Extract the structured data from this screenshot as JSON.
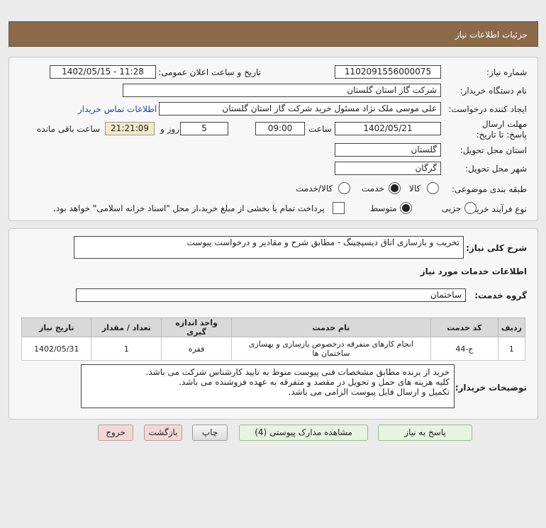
{
  "header": {
    "title": "جزئیات اطلاعات نیاز"
  },
  "form": {
    "need_number_label": "شماره نیاز:",
    "need_number": "1102091556000075",
    "announce_label": "تاریخ و ساعت اعلان عمومی:",
    "announce_value": "1402/05/15 - 11:28",
    "buyer_org_label": "نام دستگاه خریدار:",
    "buyer_org": "شرکت گاز استان گلستان",
    "creator_label": "ایجاد کننده درخواست:",
    "creator": "علی موسی ملک نژاد مسئول خرید شرکت گاز استان گلستان",
    "contact_link": "اطلاعات تماس خریدار",
    "deadline_label": "مهلت ارسال پاسخ: تا تاریخ:",
    "deadline_date": "1402/05/21",
    "time_label": "ساعت",
    "deadline_time": "09:00",
    "days_label": "روز و",
    "days": "5",
    "remaining_time": "21:21:09",
    "remaining_label": "ساعت باقی مانده",
    "province_label": "استان محل تحویل:",
    "province": "گلستان",
    "city_label": "شهر محل تحویل:",
    "city": "گرگان",
    "category_label": "طبقه بندی موضوعی:",
    "category_options": [
      "کالا",
      "خدمت",
      "کالا/خدمت"
    ],
    "category_selected": "خدمت",
    "process_label": "نوع فرآیند خرید :",
    "process_options": [
      "جزیی",
      "متوسط"
    ],
    "process_selected": "متوسط",
    "payment_note": "پرداخت تمام یا بخشی از مبلغ خرید،از محل \"اسناد خزانه اسلامی\" خواهد بود."
  },
  "details": {
    "summary_label": "شرح کلی نیاز:",
    "summary": "تخریب و بازسازی اتاق دیسپچینگ - مطابق شرح و مقادیر و درخواست پیوست",
    "services_heading": "اطلاعات خدمات مورد نیاز",
    "service_group_label": "گروه خدمت:",
    "service_group": "ساختمان",
    "table": {
      "headers": [
        "ردیف",
        "کد خدمت",
        "نام خدمت",
        "واحد اندازه گیری",
        "تعداد / مقدار",
        "تاریخ نیاز"
      ],
      "rows": [
        [
          "1",
          "ج-44",
          "انجام کارهای متفرقه درخصوص بازسازی و بهسازی ساختمان ها",
          "فقره",
          "1",
          "1402/05/31"
        ]
      ]
    },
    "buyer_notes_label": "توضیحات خریدار:",
    "buyer_notes": [
      "خرید از برنده مطابق مشخصات فنی پیوست منوط به تایید کارشناس شرکت می باشد.",
      "کلیه هزینه های حمل و تحویل در مقصد  و متفرقه به عهده فروشنده می باشد.",
      "تکمیل و ارسال فایل پیوست الزامی می باشد."
    ]
  },
  "buttons": {
    "reply": "پاسخ به نیاز",
    "view_docs": "مشاهده مدارک پیوستی (4)",
    "print": "چاپ",
    "back": "بازگشت",
    "exit": "خروج"
  }
}
